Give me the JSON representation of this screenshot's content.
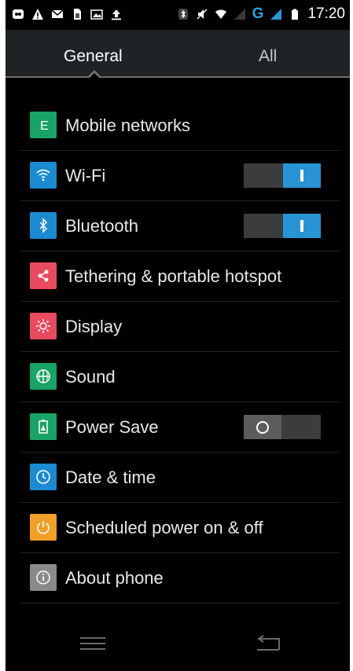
{
  "status_bar": {
    "time": "17:20",
    "network_type": "G",
    "icons": [
      "bbm-icon",
      "warning-icon",
      "gmail-icon",
      "sim-icon",
      "image-icon",
      "upload-icon",
      "bluetooth-icon",
      "mute-icon",
      "wifi-icon",
      "signal-icon",
      "battery-icon"
    ]
  },
  "tabs": [
    {
      "label": "General",
      "active": true
    },
    {
      "label": "All",
      "active": false
    }
  ],
  "settings": [
    {
      "label": "Mobile networks",
      "icon": "mobile-network-icon",
      "color": "#1aa366"
    },
    {
      "label": "Wi-Fi",
      "icon": "wifi-icon",
      "color": "#1b8ad1",
      "toggle": "on"
    },
    {
      "label": "Bluetooth",
      "icon": "bluetooth-icon",
      "color": "#1b8ad1",
      "toggle": "on"
    },
    {
      "label": "Tethering & portable hotspot",
      "icon": "share-icon",
      "color": "#e84a5f"
    },
    {
      "label": "Display",
      "icon": "brightness-icon",
      "color": "#e84a5f"
    },
    {
      "label": "Sound",
      "icon": "sound-icon",
      "color": "#1aa366"
    },
    {
      "label": "Power Save",
      "icon": "battery-save-icon",
      "color": "#1aa366",
      "toggle": "off"
    },
    {
      "label": "Date & time",
      "icon": "clock-icon",
      "color": "#1b8ad1"
    },
    {
      "label": "Scheduled power on & off",
      "icon": "power-icon",
      "color": "#f0a028"
    },
    {
      "label": "About phone",
      "icon": "info-icon",
      "color": "#8a8a8a"
    }
  ],
  "nav": [
    "menu-icon",
    "back-icon"
  ]
}
